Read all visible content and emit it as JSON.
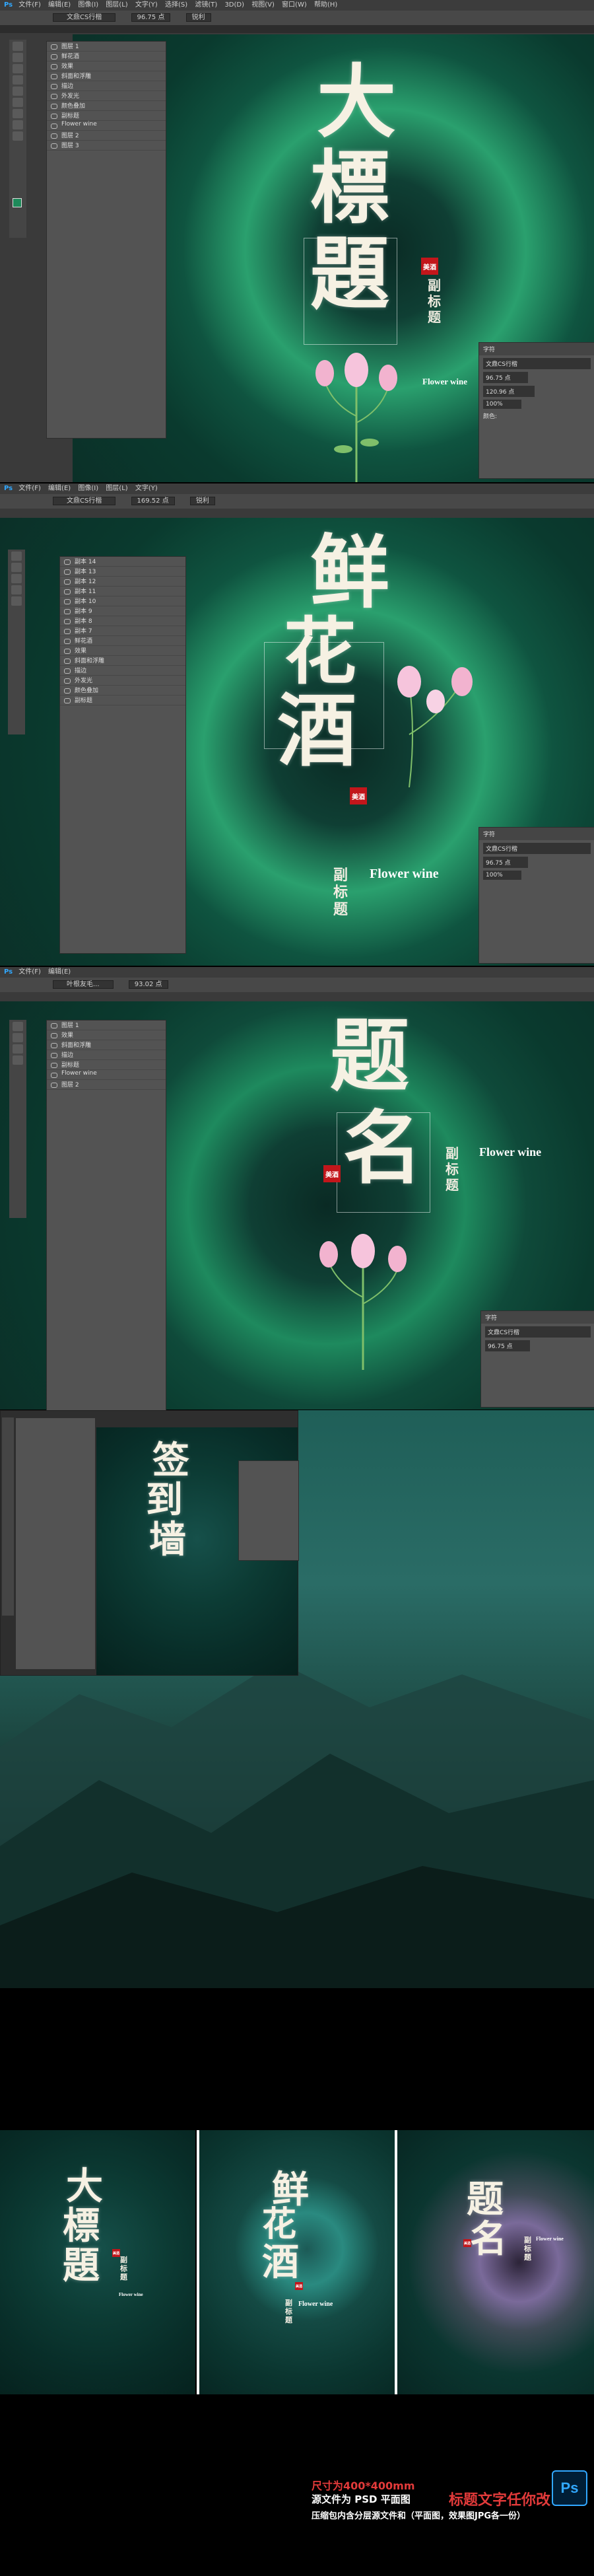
{
  "app": {
    "logo": "Ps",
    "menu": [
      "文件(F)",
      "编辑(E)",
      "图像(I)",
      "图层(L)",
      "文字(Y)",
      "选择(S)",
      "滤镜(T)",
      "3D(D)",
      "视图(V)",
      "窗口(W)",
      "帮助(H)"
    ],
    "font_select_1": "文鼎CS行楷",
    "font_select_2": "文鼎CS行楷",
    "font_select_3": "叶根友毛...",
    "size_1": "96.75 点",
    "size_2": "169.52 点",
    "size_3": "93.02 点",
    "aa": "锐利"
  },
  "screen1": {
    "title_chars": [
      "大",
      "標",
      "題"
    ],
    "seal": "美酒",
    "subtitle": "副标题",
    "english": "Flower wine"
  },
  "screen2": {
    "title_chars": [
      "鲜",
      "花",
      "酒"
    ],
    "seal": "美酒",
    "subtitle": "副标题",
    "english": "Flower wine"
  },
  "screen3": {
    "title_chars": [
      "题",
      "名"
    ],
    "seal": "美酒",
    "subtitle": "副标题",
    "english": "Flower wine"
  },
  "screen4": {
    "title_chars": [
      "签",
      "到",
      "墙"
    ]
  },
  "layers": {
    "items": [
      "副本 14",
      "副本 13",
      "副本 12",
      "副本 11",
      "副本 10",
      "副本 9",
      "副本 8",
      "副本 7",
      "图层 1",
      "鲜花酒",
      "效果",
      "斜面和浮雕",
      "描边",
      "外发光",
      "颜色叠加",
      "副标题",
      "Flower wine",
      "图层 2",
      "图层 3"
    ]
  },
  "properties": {
    "title": "字符",
    "font": "文鼎CS行楷",
    "size": "96.75 点",
    "leading": "120.96 点",
    "tracking": "0",
    "scale": "100%",
    "color_label": "颜色:"
  },
  "previews": {
    "items": [
      {
        "chars": [
          "大",
          "標",
          "題"
        ],
        "seal": "美酒",
        "subtitle": "副标题",
        "english": "Flower wine"
      },
      {
        "chars": [
          "鲜",
          "花",
          "酒"
        ],
        "seal": "美酒",
        "subtitle": "副标题",
        "english": "Flower wine"
      },
      {
        "chars": [
          "题",
          "名"
        ],
        "seal": "美酒",
        "subtitle": "副标题",
        "english": "Flower wine"
      }
    ]
  },
  "footer": {
    "size_text": "尺寸为400*400mm",
    "editable_text": "标题文字任你改",
    "format_text": "源文件为 PSD 平面图",
    "package_text": "压缩包内含分层源文件和（平面图，效果图JPG各一份）",
    "ps_badge": "Ps"
  },
  "colors": {
    "ps_blue": "#31a8ff",
    "ps_dark": "#001e36",
    "accent_red": "#e23a3a",
    "bg_green": "#0b3a33"
  }
}
